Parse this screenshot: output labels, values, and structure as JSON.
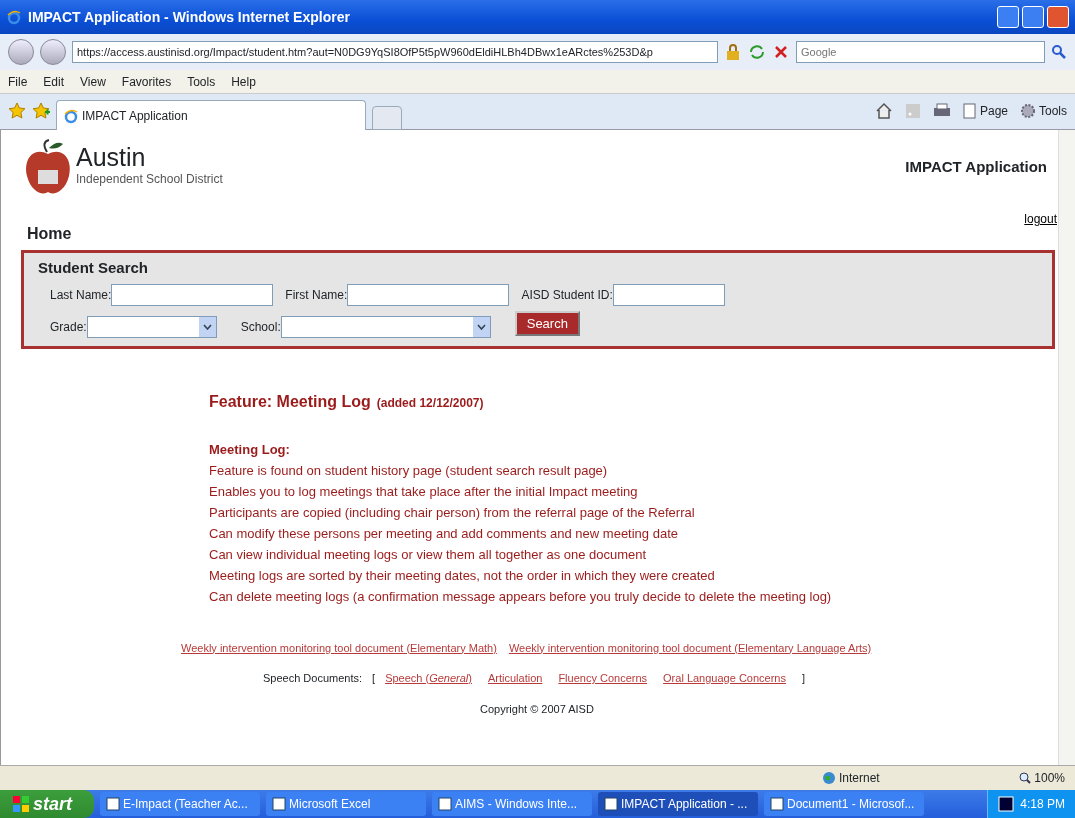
{
  "window": {
    "title": "IMPACT Application - Windows Internet Explorer"
  },
  "address_bar": {
    "url": "https://access.austinisd.org/Impact/student.htm?aut=N0DG9YqSI8OfP5t5pW960dEldiHLBh4DBwx1eARctes%253D&p",
    "search_placeholder": "Google"
  },
  "menu": [
    "File",
    "Edit",
    "View",
    "Favorites",
    "Tools",
    "Help"
  ],
  "tabs": [
    {
      "label": "IMPACT Application",
      "selected": true
    }
  ],
  "command_bar": {
    "page": "Page",
    "tools": "Tools"
  },
  "page": {
    "logo": {
      "name": "Austin",
      "subtitle": "Independent School District"
    },
    "app_title": "IMPACT Application",
    "heading": "Home",
    "logout": "logout",
    "student_search": {
      "title": "Student Search",
      "fields": [
        {
          "label": "Last Name:",
          "kind": "text"
        },
        {
          "label": "First Name:",
          "kind": "text"
        },
        {
          "label": "AISD Student ID:",
          "kind": "text"
        }
      ],
      "selects": [
        {
          "label": "Grade:"
        },
        {
          "label": "School:"
        }
      ],
      "button": "Search"
    },
    "feature": {
      "title": "Feature: Meeting Log",
      "date": "(added 12/12/2007)",
      "subtitle": "Meeting Log:",
      "items": [
        "Feature is found on student history page (student search result page)",
        "Enables you to log meetings that take place after the initial Impact meeting",
        "Participants are copied (including chair person) from the referral page of the Referral",
        "Can modify these persons per meeting and add comments and new meeting date",
        "Can view individual meeting logs or view them all together as one document",
        "Meeting logs are sorted by their meeting dates, not the order in which they were created",
        "Can delete meeting logs (a confirmation message appears before you truly decide to delete the meeting log)"
      ]
    },
    "doc_links": [
      "Weekly intervention monitoring tool document (Elementary Math)",
      "Weekly intervention monitoring tool document (Elementary Language Arts)"
    ],
    "speech": {
      "label": "Speech Documents:",
      "open": "[",
      "links": [
        "Speech (*General*)",
        "Articulation",
        "Fluency Concerns",
        "Oral Language Concerns"
      ],
      "close": "]"
    },
    "copyright": "Copyright © 2007 AISD"
  },
  "status_bar": {
    "zone": "Internet",
    "zoom": "100%"
  },
  "taskbar": {
    "start": "start",
    "items": [
      {
        "label": "E-Impact (Teacher Ac...",
        "selected": false
      },
      {
        "label": "Microsoft Excel",
        "selected": false
      },
      {
        "label": "AIMS - Windows Inte...",
        "selected": false
      },
      {
        "label": "IMPACT Application - ...",
        "selected": true
      },
      {
        "label": "Document1 - Microsof...",
        "selected": false
      }
    ],
    "clock": "4:18 PM"
  }
}
